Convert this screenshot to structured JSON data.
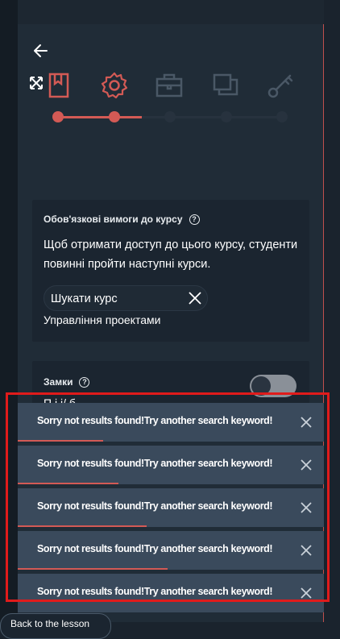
{
  "stepper": {
    "steps": [
      {
        "icon": "book-icon",
        "status": "completed"
      },
      {
        "icon": "gear-icon",
        "status": "active"
      },
      {
        "icon": "briefcase-icon",
        "status": "pending"
      },
      {
        "icon": "copy-icon",
        "status": "pending"
      },
      {
        "icon": "key-icon",
        "status": "pending"
      }
    ]
  },
  "prerequisites": {
    "title": "Обов'язкові вимоги до курсу",
    "help": "?",
    "description": "Щоб отримати доступ до цього курсу, студенти повинні пройти наступні курси.",
    "search_value": "",
    "search_placeholder": "Шукати курс",
    "result": "Управління проектами"
  },
  "locks": {
    "title": "Замки",
    "help": "?",
    "enabled": false,
    "partial_text": "П                   і       і/                    б"
  },
  "toasts": [
    {
      "message": "Sorry not results found!Try another search keyword!",
      "progress": 0.28
    },
    {
      "message": "Sorry not results found!Try another search keyword!",
      "progress": 0.33
    },
    {
      "message": "Sorry not results found!Try another search keyword!",
      "progress": 0.42
    },
    {
      "message": "Sorry not results found!Try another search keyword!",
      "progress": 0.49
    },
    {
      "message": "Sorry not results found!Try another search keyword!",
      "progress": 0.0
    }
  ],
  "bottom_button": {
    "label": "Back to the lesson"
  },
  "colors": {
    "accent": "#d35a55",
    "inactive": "#3a4652",
    "toast_bg": "#3a4a5c",
    "highlight": "#e01b1b"
  }
}
